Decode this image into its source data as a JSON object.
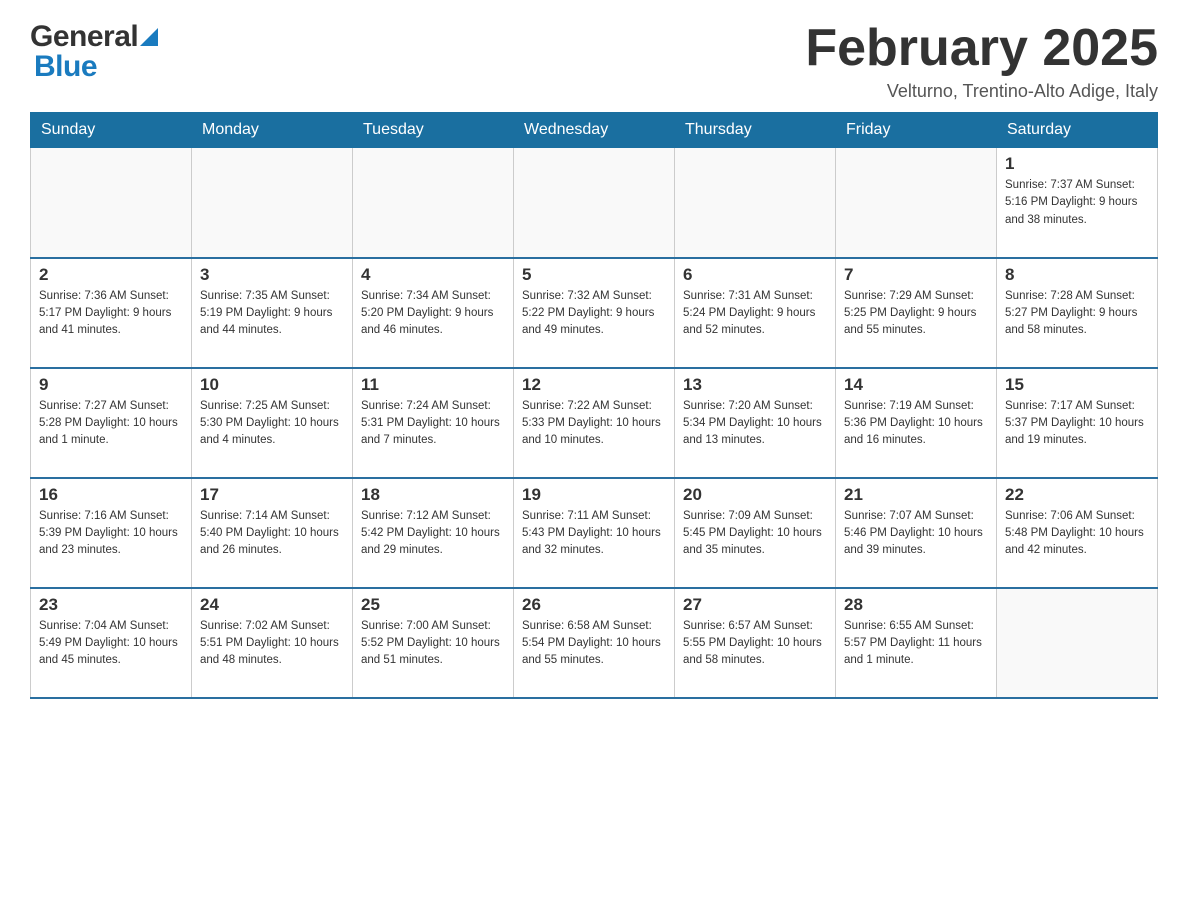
{
  "header": {
    "title": "February 2025",
    "subtitle": "Velturno, Trentino-Alto Adige, Italy",
    "logo_general": "General",
    "logo_blue": "Blue"
  },
  "calendar": {
    "days_of_week": [
      "Sunday",
      "Monday",
      "Tuesday",
      "Wednesday",
      "Thursday",
      "Friday",
      "Saturday"
    ],
    "weeks": [
      {
        "cells": [
          {
            "day": "",
            "info": ""
          },
          {
            "day": "",
            "info": ""
          },
          {
            "day": "",
            "info": ""
          },
          {
            "day": "",
            "info": ""
          },
          {
            "day": "",
            "info": ""
          },
          {
            "day": "",
            "info": ""
          },
          {
            "day": "1",
            "info": "Sunrise: 7:37 AM\nSunset: 5:16 PM\nDaylight: 9 hours\nand 38 minutes."
          }
        ]
      },
      {
        "cells": [
          {
            "day": "2",
            "info": "Sunrise: 7:36 AM\nSunset: 5:17 PM\nDaylight: 9 hours\nand 41 minutes."
          },
          {
            "day": "3",
            "info": "Sunrise: 7:35 AM\nSunset: 5:19 PM\nDaylight: 9 hours\nand 44 minutes."
          },
          {
            "day": "4",
            "info": "Sunrise: 7:34 AM\nSunset: 5:20 PM\nDaylight: 9 hours\nand 46 minutes."
          },
          {
            "day": "5",
            "info": "Sunrise: 7:32 AM\nSunset: 5:22 PM\nDaylight: 9 hours\nand 49 minutes."
          },
          {
            "day": "6",
            "info": "Sunrise: 7:31 AM\nSunset: 5:24 PM\nDaylight: 9 hours\nand 52 minutes."
          },
          {
            "day": "7",
            "info": "Sunrise: 7:29 AM\nSunset: 5:25 PM\nDaylight: 9 hours\nand 55 minutes."
          },
          {
            "day": "8",
            "info": "Sunrise: 7:28 AM\nSunset: 5:27 PM\nDaylight: 9 hours\nand 58 minutes."
          }
        ]
      },
      {
        "cells": [
          {
            "day": "9",
            "info": "Sunrise: 7:27 AM\nSunset: 5:28 PM\nDaylight: 10 hours\nand 1 minute."
          },
          {
            "day": "10",
            "info": "Sunrise: 7:25 AM\nSunset: 5:30 PM\nDaylight: 10 hours\nand 4 minutes."
          },
          {
            "day": "11",
            "info": "Sunrise: 7:24 AM\nSunset: 5:31 PM\nDaylight: 10 hours\nand 7 minutes."
          },
          {
            "day": "12",
            "info": "Sunrise: 7:22 AM\nSunset: 5:33 PM\nDaylight: 10 hours\nand 10 minutes."
          },
          {
            "day": "13",
            "info": "Sunrise: 7:20 AM\nSunset: 5:34 PM\nDaylight: 10 hours\nand 13 minutes."
          },
          {
            "day": "14",
            "info": "Sunrise: 7:19 AM\nSunset: 5:36 PM\nDaylight: 10 hours\nand 16 minutes."
          },
          {
            "day": "15",
            "info": "Sunrise: 7:17 AM\nSunset: 5:37 PM\nDaylight: 10 hours\nand 19 minutes."
          }
        ]
      },
      {
        "cells": [
          {
            "day": "16",
            "info": "Sunrise: 7:16 AM\nSunset: 5:39 PM\nDaylight: 10 hours\nand 23 minutes."
          },
          {
            "day": "17",
            "info": "Sunrise: 7:14 AM\nSunset: 5:40 PM\nDaylight: 10 hours\nand 26 minutes."
          },
          {
            "day": "18",
            "info": "Sunrise: 7:12 AM\nSunset: 5:42 PM\nDaylight: 10 hours\nand 29 minutes."
          },
          {
            "day": "19",
            "info": "Sunrise: 7:11 AM\nSunset: 5:43 PM\nDaylight: 10 hours\nand 32 minutes."
          },
          {
            "day": "20",
            "info": "Sunrise: 7:09 AM\nSunset: 5:45 PM\nDaylight: 10 hours\nand 35 minutes."
          },
          {
            "day": "21",
            "info": "Sunrise: 7:07 AM\nSunset: 5:46 PM\nDaylight: 10 hours\nand 39 minutes."
          },
          {
            "day": "22",
            "info": "Sunrise: 7:06 AM\nSunset: 5:48 PM\nDaylight: 10 hours\nand 42 minutes."
          }
        ]
      },
      {
        "cells": [
          {
            "day": "23",
            "info": "Sunrise: 7:04 AM\nSunset: 5:49 PM\nDaylight: 10 hours\nand 45 minutes."
          },
          {
            "day": "24",
            "info": "Sunrise: 7:02 AM\nSunset: 5:51 PM\nDaylight: 10 hours\nand 48 minutes."
          },
          {
            "day": "25",
            "info": "Sunrise: 7:00 AM\nSunset: 5:52 PM\nDaylight: 10 hours\nand 51 minutes."
          },
          {
            "day": "26",
            "info": "Sunrise: 6:58 AM\nSunset: 5:54 PM\nDaylight: 10 hours\nand 55 minutes."
          },
          {
            "day": "27",
            "info": "Sunrise: 6:57 AM\nSunset: 5:55 PM\nDaylight: 10 hours\nand 58 minutes."
          },
          {
            "day": "28",
            "info": "Sunrise: 6:55 AM\nSunset: 5:57 PM\nDaylight: 11 hours\nand 1 minute."
          },
          {
            "day": "",
            "info": ""
          }
        ]
      }
    ]
  }
}
